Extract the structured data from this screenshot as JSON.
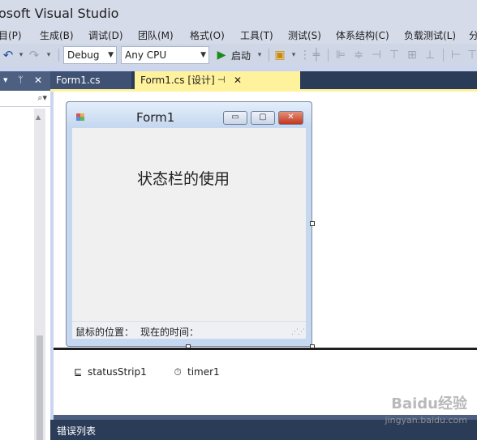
{
  "window": {
    "title": "osoft Visual Studio"
  },
  "menu": [
    "目(P)",
    "生成(B)",
    "调试(D)",
    "团队(M)",
    "格式(O)",
    "工具(T)",
    "测试(S)",
    "体系结构(C)",
    "负载测试(L)",
    "分"
  ],
  "toolbar": {
    "config": "Debug",
    "platform": "Any CPU",
    "start_label": "启动"
  },
  "tabs": [
    {
      "label": "Form1.cs",
      "active": false
    },
    {
      "label": "Form1.cs [设计]",
      "active": true
    }
  ],
  "form": {
    "title": "Form1",
    "center_label": "状态栏的使用",
    "status_items": [
      "鼠标的位置：",
      "现在的时间："
    ]
  },
  "tray": [
    {
      "icon": "status-strip-icon",
      "label": "statusStrip1"
    },
    {
      "icon": "timer-icon",
      "label": "timer1"
    }
  ],
  "error_list": "错误列表",
  "watermark": {
    "main": "Baidu经验",
    "sub": "jingyan.baidu.com"
  },
  "colors": {
    "accent_tab": "#fff29d",
    "dark_panel": "#2b3c59",
    "close_red": "#c1361c"
  }
}
